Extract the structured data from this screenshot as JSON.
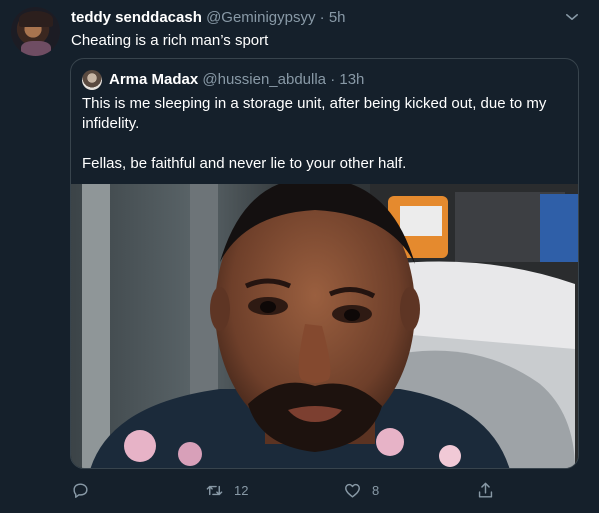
{
  "tweet": {
    "display_name": "teddy senddacash",
    "handle": "@Geminigypsyy",
    "separator": "·",
    "time": "5h",
    "text": "Cheating is a rich man’s sport",
    "menu_icon": "chevron-down-icon"
  },
  "quoted": {
    "display_name": "Arma Madax",
    "handle": "@hussien_abdulla",
    "separator": "·",
    "time": "13h",
    "text": "This is me sleeping in a storage unit, after being kicked out, due to my infidelity.\n\nFellas, be faithful and never lie to your other half.",
    "media": "selfie-photo"
  },
  "actions": {
    "reply": {
      "icon": "reply-icon",
      "count": ""
    },
    "retweet": {
      "icon": "retweet-icon",
      "count": "12"
    },
    "like": {
      "icon": "heart-icon",
      "count": "8"
    },
    "share": {
      "icon": "share-icon",
      "count": ""
    }
  },
  "colors": {
    "background": "#15202b",
    "secondary_text": "#8899a6",
    "border": "#38444d",
    "primary_text": "#ffffff"
  }
}
